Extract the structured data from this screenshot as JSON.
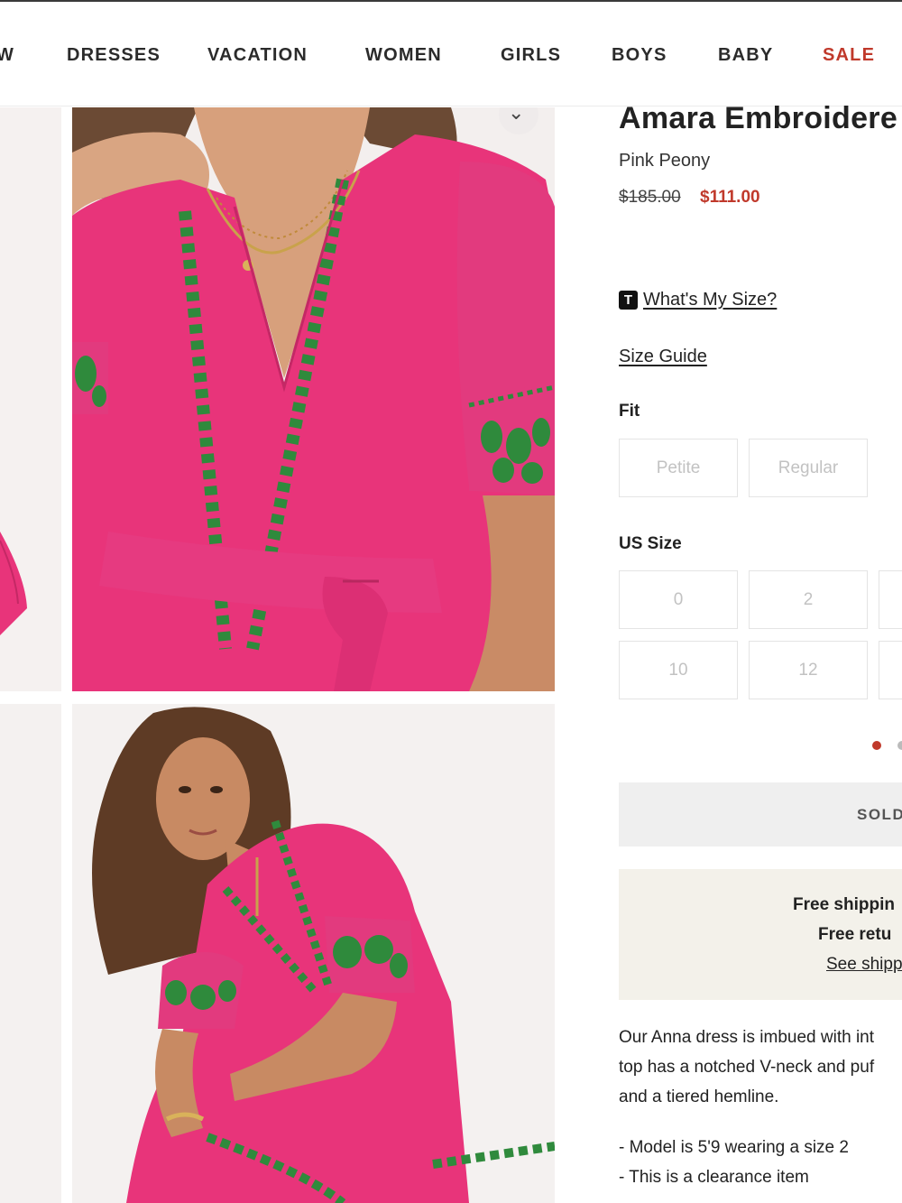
{
  "nav": {
    "items": [
      "W",
      "DRESSES",
      "VACATION",
      "WOMEN",
      "GIRLS",
      "BOYS",
      "BABY",
      "SALE"
    ],
    "sale_color": "#c0392b"
  },
  "product": {
    "title": "Amara Embroidere",
    "color_name": "Pink Peony",
    "price_original": "$185.00",
    "price_sale": "$111.00",
    "whats_my_size_badge": "T",
    "whats_my_size": "What's My Size?",
    "size_guide": "Size Guide"
  },
  "fit": {
    "label": "Fit",
    "options": [
      "Petite",
      "Regular"
    ]
  },
  "sizes": {
    "label": "US Size",
    "row1": [
      "0",
      "2",
      ""
    ],
    "row2": [
      "10",
      "12",
      ""
    ]
  },
  "actions": {
    "sold_out_label": "SOLD"
  },
  "shipping": {
    "line1": "Free shippin",
    "line2": "Free retu",
    "link": "See shipp"
  },
  "description": {
    "lines": [
      "Our Anna dress is imbued with int",
      "top has a notched V-neck and puf",
      "and a tiered hemline."
    ],
    "bullets": [
      "- Model is 5'9 wearing a size 2",
      "- This is a clearance item"
    ]
  },
  "colors": {
    "accent_red": "#c0392b",
    "dress_pink": "#e8347a",
    "embroidery_green": "#2f8a3c",
    "shipping_bg": "#f3f1ea"
  },
  "icons": [
    "chevron-down-icon",
    "size-badge-icon",
    "carousel-dot-icon"
  ]
}
